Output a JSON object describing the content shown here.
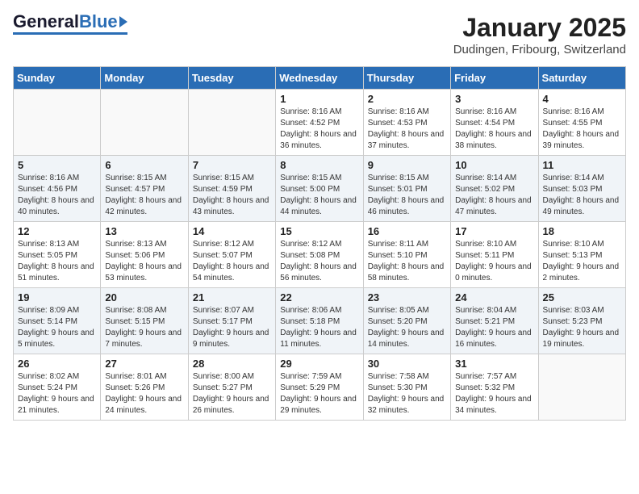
{
  "header": {
    "logo_general": "General",
    "logo_blue": "Blue",
    "month_title": "January 2025",
    "location": "Dudingen, Fribourg, Switzerland"
  },
  "days_of_week": [
    "Sunday",
    "Monday",
    "Tuesday",
    "Wednesday",
    "Thursday",
    "Friday",
    "Saturday"
  ],
  "weeks": [
    [
      {
        "day": "",
        "info": ""
      },
      {
        "day": "",
        "info": ""
      },
      {
        "day": "",
        "info": ""
      },
      {
        "day": "1",
        "info": "Sunrise: 8:16 AM\nSunset: 4:52 PM\nDaylight: 8 hours and 36 minutes."
      },
      {
        "day": "2",
        "info": "Sunrise: 8:16 AM\nSunset: 4:53 PM\nDaylight: 8 hours and 37 minutes."
      },
      {
        "day": "3",
        "info": "Sunrise: 8:16 AM\nSunset: 4:54 PM\nDaylight: 8 hours and 38 minutes."
      },
      {
        "day": "4",
        "info": "Sunrise: 8:16 AM\nSunset: 4:55 PM\nDaylight: 8 hours and 39 minutes."
      }
    ],
    [
      {
        "day": "5",
        "info": "Sunrise: 8:16 AM\nSunset: 4:56 PM\nDaylight: 8 hours and 40 minutes."
      },
      {
        "day": "6",
        "info": "Sunrise: 8:15 AM\nSunset: 4:57 PM\nDaylight: 8 hours and 42 minutes."
      },
      {
        "day": "7",
        "info": "Sunrise: 8:15 AM\nSunset: 4:59 PM\nDaylight: 8 hours and 43 minutes."
      },
      {
        "day": "8",
        "info": "Sunrise: 8:15 AM\nSunset: 5:00 PM\nDaylight: 8 hours and 44 minutes."
      },
      {
        "day": "9",
        "info": "Sunrise: 8:15 AM\nSunset: 5:01 PM\nDaylight: 8 hours and 46 minutes."
      },
      {
        "day": "10",
        "info": "Sunrise: 8:14 AM\nSunset: 5:02 PM\nDaylight: 8 hours and 47 minutes."
      },
      {
        "day": "11",
        "info": "Sunrise: 8:14 AM\nSunset: 5:03 PM\nDaylight: 8 hours and 49 minutes."
      }
    ],
    [
      {
        "day": "12",
        "info": "Sunrise: 8:13 AM\nSunset: 5:05 PM\nDaylight: 8 hours and 51 minutes."
      },
      {
        "day": "13",
        "info": "Sunrise: 8:13 AM\nSunset: 5:06 PM\nDaylight: 8 hours and 53 minutes."
      },
      {
        "day": "14",
        "info": "Sunrise: 8:12 AM\nSunset: 5:07 PM\nDaylight: 8 hours and 54 minutes."
      },
      {
        "day": "15",
        "info": "Sunrise: 8:12 AM\nSunset: 5:08 PM\nDaylight: 8 hours and 56 minutes."
      },
      {
        "day": "16",
        "info": "Sunrise: 8:11 AM\nSunset: 5:10 PM\nDaylight: 8 hours and 58 minutes."
      },
      {
        "day": "17",
        "info": "Sunrise: 8:10 AM\nSunset: 5:11 PM\nDaylight: 9 hours and 0 minutes."
      },
      {
        "day": "18",
        "info": "Sunrise: 8:10 AM\nSunset: 5:13 PM\nDaylight: 9 hours and 2 minutes."
      }
    ],
    [
      {
        "day": "19",
        "info": "Sunrise: 8:09 AM\nSunset: 5:14 PM\nDaylight: 9 hours and 5 minutes."
      },
      {
        "day": "20",
        "info": "Sunrise: 8:08 AM\nSunset: 5:15 PM\nDaylight: 9 hours and 7 minutes."
      },
      {
        "day": "21",
        "info": "Sunrise: 8:07 AM\nSunset: 5:17 PM\nDaylight: 9 hours and 9 minutes."
      },
      {
        "day": "22",
        "info": "Sunrise: 8:06 AM\nSunset: 5:18 PM\nDaylight: 9 hours and 11 minutes."
      },
      {
        "day": "23",
        "info": "Sunrise: 8:05 AM\nSunset: 5:20 PM\nDaylight: 9 hours and 14 minutes."
      },
      {
        "day": "24",
        "info": "Sunrise: 8:04 AM\nSunset: 5:21 PM\nDaylight: 9 hours and 16 minutes."
      },
      {
        "day": "25",
        "info": "Sunrise: 8:03 AM\nSunset: 5:23 PM\nDaylight: 9 hours and 19 minutes."
      }
    ],
    [
      {
        "day": "26",
        "info": "Sunrise: 8:02 AM\nSunset: 5:24 PM\nDaylight: 9 hours and 21 minutes."
      },
      {
        "day": "27",
        "info": "Sunrise: 8:01 AM\nSunset: 5:26 PM\nDaylight: 9 hours and 24 minutes."
      },
      {
        "day": "28",
        "info": "Sunrise: 8:00 AM\nSunset: 5:27 PM\nDaylight: 9 hours and 26 minutes."
      },
      {
        "day": "29",
        "info": "Sunrise: 7:59 AM\nSunset: 5:29 PM\nDaylight: 9 hours and 29 minutes."
      },
      {
        "day": "30",
        "info": "Sunrise: 7:58 AM\nSunset: 5:30 PM\nDaylight: 9 hours and 32 minutes."
      },
      {
        "day": "31",
        "info": "Sunrise: 7:57 AM\nSunset: 5:32 PM\nDaylight: 9 hours and 34 minutes."
      },
      {
        "day": "",
        "info": ""
      }
    ]
  ]
}
